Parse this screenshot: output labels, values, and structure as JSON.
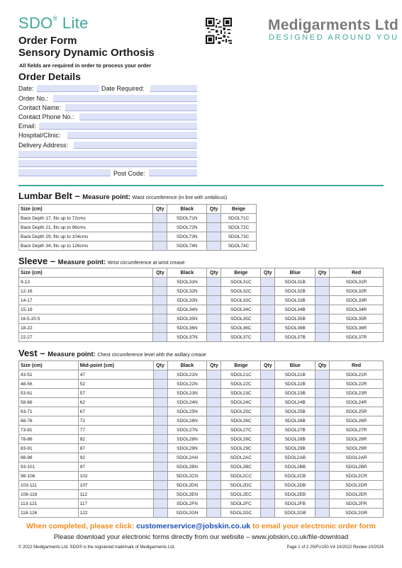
{
  "header": {
    "logo_main": "SDO",
    "logo_reg": "®",
    "logo_sub": " Lite",
    "title_line1": "Order Form",
    "title_line2": "Sensory Dynamic Orthosis",
    "note": "All fields are required in order to process your order",
    "brand": "Medigarments Ltd",
    "tagline": "DESIGNED AROUND YOU"
  },
  "order_details": {
    "heading": "Order Details",
    "date_label": "Date:",
    "date_required_label": "Date Required:",
    "order_no_label": "Order No.:",
    "contact_name_label": "Contact Name:",
    "contact_phone_label": "Contact Phone No.:",
    "email_label": "Email:",
    "hospital_label": "Hospital/Clinic:",
    "delivery_label": "Delivery Address:",
    "post_code_label": "Post Code:"
  },
  "lumbar": {
    "title": "Lumbar Belt – ",
    "mp_label": "Measure point: ",
    "mp_desc": "Waist circumference (in line with umbilicus)",
    "headers": [
      "Size (cm)",
      "Qty",
      "Black",
      "Qty",
      "Beige"
    ],
    "rows": [
      [
        "Back Depth 17, fits up to 72cms",
        "SDOL71N",
        "SDOL71C"
      ],
      [
        "Back Depth 21, fits up to 96cms",
        "SDOL72N",
        "SDOL72C"
      ],
      [
        "Back Depth 29, fits up to 104cms",
        "SDOL73N",
        "SDOL73C"
      ],
      [
        "Back Depth 34, fits up to 126cms",
        "SDOL74N",
        "SDOL74C"
      ]
    ]
  },
  "sleeve": {
    "title": "Sleeve – ",
    "mp_label": "Measure point: ",
    "mp_desc": "Wrist circumference at wrist crease",
    "headers": [
      "Size (cm)",
      "Qty",
      "Black",
      "Qty",
      "Beige",
      "Qty",
      "Blue",
      "Qty",
      "Red"
    ],
    "rows": [
      [
        "9-13",
        "SDOL31N",
        "SDOL31C",
        "SDOL31B",
        "SDOL31R"
      ],
      [
        "12-16",
        "SDOL32N",
        "SDOL32C",
        "SDOL32B",
        "SDOL32R"
      ],
      [
        "14-17",
        "SDOL33N",
        "SDOL33C",
        "SDOL33B",
        "SDOL33R"
      ],
      [
        "15-19",
        "SDOL34N",
        "SDOL34C",
        "SDOL34B",
        "SDOL34R"
      ],
      [
        "16.5-20.5",
        "SDOL35N",
        "SDOL35C",
        "SDOL35B",
        "SDOL35R"
      ],
      [
        "18-22",
        "SDOL36N",
        "SDOL36C",
        "SDOL36B",
        "SDOL36R"
      ],
      [
        "22-27",
        "SDOL37N",
        "SDOL37C",
        "SDOL37B",
        "SDOL37R"
      ]
    ]
  },
  "vest": {
    "title": "Vest – ",
    "mp_label": "Measure point: ",
    "mp_desc": "Chest circumference level with the axillary crease",
    "headers": [
      "Size (cm)",
      "Mid-point (cm)",
      "Qty",
      "Black",
      "Qty",
      "Beige",
      "Qty",
      "Blue",
      "Qty",
      "Red"
    ],
    "rows": [
      [
        "43-51",
        "47",
        "SDOL21N",
        "SDOL21C",
        "SDOL21B",
        "SDOL21R"
      ],
      [
        "48-56",
        "52",
        "SDOL22N",
        "SDOL22C",
        "SDOL22B",
        "SDOL22R"
      ],
      [
        "53-61",
        "57",
        "SDOL23N",
        "SDOL23C",
        "SDOL23B",
        "SDOL23R"
      ],
      [
        "58-66",
        "62",
        "SDOL24N",
        "SDOL24C",
        "SDOL24B",
        "SDOL24R"
      ],
      [
        "63-71",
        "67",
        "SDOL25N",
        "SDOL25C",
        "SDOL25B",
        "SDOL25R"
      ],
      [
        "68-76",
        "72",
        "SDOL26N",
        "SDOL26C",
        "SDOL26B",
        "SDOL26R"
      ],
      [
        "73-81",
        "77",
        "SDOL27N",
        "SDOL27C",
        "SDOL27B",
        "SDOL27R"
      ],
      [
        "78-86",
        "82",
        "SDOL28N",
        "SDOL28C",
        "SDOL28B",
        "SDOL28R"
      ],
      [
        "83-91",
        "87",
        "SDOL29N",
        "SDOL29C",
        "SDOL29B",
        "SDOL29R"
      ],
      [
        "88-96",
        "92",
        "SDOL2AN",
        "SDOL2AC",
        "SDOL2AB",
        "SDOL2AR"
      ],
      [
        "93-101",
        "97",
        "SDOL2BN",
        "SDOL2BC",
        "SDOL2BB",
        "SDOL2BR"
      ],
      [
        "98-106",
        "102",
        "SDOL2CN",
        "SDOL2CC",
        "SDOL2CB",
        "SDOL2CR"
      ],
      [
        "103-111",
        "107",
        "SDOL2DN",
        "SDOL2DC",
        "SDOL2DB",
        "SDOL2DR"
      ],
      [
        "108-116",
        "112",
        "SDOL2EN",
        "SDOL2EC",
        "SDOL2EB",
        "SDOL2ER"
      ],
      [
        "113-121",
        "117",
        "SDOL2FN",
        "SDOL2FC",
        "SDOL2FB",
        "SDOL2FR"
      ],
      [
        "118-126",
        "122",
        "SDOL2GN",
        "SDOL2GC",
        "SDOL2GB",
        "SDOL2GR"
      ]
    ]
  },
  "footer": {
    "line1_a": "When completed, please click: ",
    "email": "customerservice@jobskin.co.uk",
    "line1_b": " to email your electronic order form",
    "line2": "Please download your electronic forms directly from our website – www.jobskin.co.uk/file-download",
    "copyright": "© 2022 Medigarments Ltd. SDO® is the registered trademark of Medigarments Ltd.",
    "page_info": "Page 1 of 2  JSIFU150-V4 10/2022 Review 10/2024"
  },
  "colors": {
    "accent": "#3fa89a",
    "brand_grey": "#7b7b7b",
    "field_fill": "#dfe3f7",
    "footer_orange": "#f28b1e",
    "link_blue": "#1b4fb0"
  }
}
